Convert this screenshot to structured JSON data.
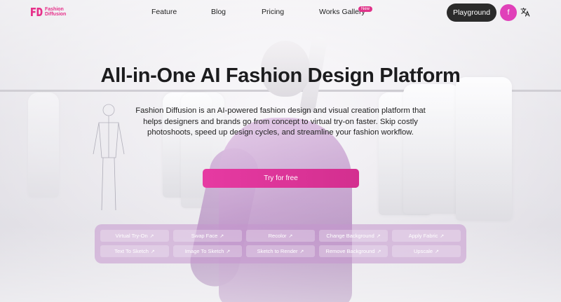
{
  "nav": {
    "logo_text_line1": "Fashion",
    "logo_text_line2": "Diffusion",
    "links": [
      "Feature",
      "Blog",
      "Pricing",
      "Works Gallery"
    ],
    "new_badge": "New",
    "playground_label": "Playground",
    "avatar_initial": "f",
    "translate_icon": "translate-icon"
  },
  "hero": {
    "title": "All-in-One AI Fashion Design Platform",
    "description": "Fashion Diffusion is an AI-powered fashion design and visual creation platform that helps designers and brands go from concept to virtual try-on faster. Skip costly photoshoots, speed up design cycles, and streamline your fashion workflow.",
    "cta_label": "Try for free"
  },
  "tools": [
    {
      "label": "Virtual Try-On",
      "icon": "↗"
    },
    {
      "label": "Swap Face",
      "icon": "↗"
    },
    {
      "label": "Recolor",
      "icon": "↗"
    },
    {
      "label": "Change Background",
      "icon": "↗"
    },
    {
      "label": "Apply Fabric",
      "icon": "↗"
    },
    {
      "label": "Text To Sketch",
      "icon": "↗"
    },
    {
      "label": "Image To Sketch",
      "icon": "↗"
    },
    {
      "label": "Sketch to Render",
      "icon": "↗"
    },
    {
      "label": "Remove Background",
      "icon": "↗"
    },
    {
      "label": "Upscale",
      "icon": "↗"
    }
  ],
  "colors": {
    "brand": "#e6318a",
    "cta": "#e63aa2",
    "playground_bg": "#2b2b2b",
    "avatar_bg": "#e040b9"
  }
}
